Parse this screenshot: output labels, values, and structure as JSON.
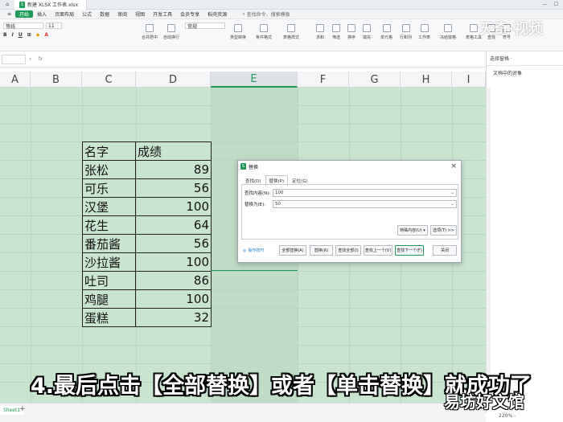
{
  "titlebar": {
    "home_icon": "home-icon",
    "doc_title": "新建 XLSX 工作表.xlsx"
  },
  "menu": {
    "items": [
      "开始",
      "插入",
      "页面布局",
      "公式",
      "数据",
      "审阅",
      "视图",
      "开发工具",
      "会员专享",
      "稻壳资源"
    ],
    "active": "开始",
    "search_placeholder": "查找命令、搜索模板"
  },
  "ribbon": {
    "font_name": "等线",
    "font_size": "11",
    "number_format": "常规",
    "groups": [
      "合并居中",
      "自动换行",
      "类型转换",
      "条件格式",
      "表格样式",
      "求和",
      "筛选",
      "排序",
      "填充",
      "单元格",
      "行和列",
      "工作表",
      "冻结窗格",
      "表格工具",
      "查找",
      "符号"
    ]
  },
  "formula": {
    "fx": "fx"
  },
  "columns": [
    "A",
    "B",
    "C",
    "D",
    "E",
    "F",
    "G",
    "H",
    "I"
  ],
  "selected_column": "E",
  "table": {
    "headers": [
      "名字",
      "成绩"
    ],
    "rows": [
      [
        "张松",
        "89"
      ],
      [
        "可乐",
        "56"
      ],
      [
        "汉堡",
        "100"
      ],
      [
        "花生",
        "64"
      ],
      [
        "番茄酱",
        "56"
      ],
      [
        "沙拉酱",
        "100"
      ],
      [
        "吐司",
        "86"
      ],
      [
        "鸡腿",
        "100"
      ],
      [
        "蛋糕",
        "32"
      ]
    ]
  },
  "right_panel": {
    "title": "选择窗格 ·",
    "item": "文档中的对象"
  },
  "sheet": {
    "tab": "Sheet1",
    "add": "+",
    "zoom": "220% -"
  },
  "dialog": {
    "title": "替换",
    "tabs": [
      "查找(D)",
      "替换(P)",
      "定位(G)"
    ],
    "active_tab": "替换(P)",
    "find_label": "查找内容(N):",
    "find_value": "100",
    "replace_label": "替换为(E):",
    "replace_value": "50",
    "special_btn": "特殊内容(U) ▾",
    "options_btn": "选项(T) >>",
    "tips": "操作技巧",
    "buttons": [
      "全部替换(A)",
      "替换(R)",
      "查找全部(I)",
      "查找上一个(V)",
      "查找下一个(F)",
      "关闭"
    ]
  },
  "subtitle": "4.最后点击【全部替换】或者【单击替换】就成功了",
  "watermark_top": "天奇·视频",
  "watermark_bottom": "易坊好文馆"
}
